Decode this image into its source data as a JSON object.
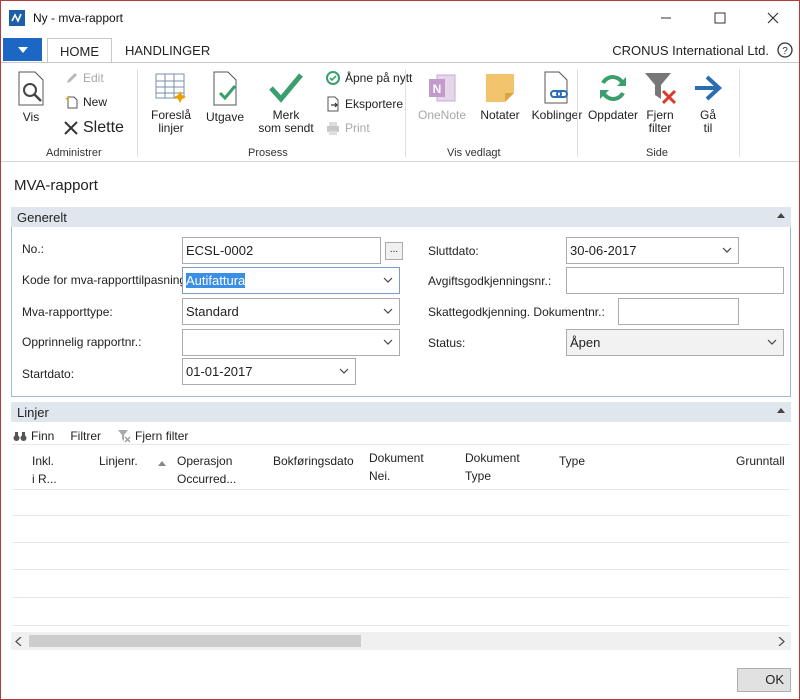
{
  "window": {
    "title": "Ny - mva-rapport"
  },
  "tabs": [
    {
      "label": "HOME"
    },
    {
      "label": "HANDLINGER"
    }
  ],
  "company": "CRONUS International Ltd.",
  "ribbon": {
    "administrer": {
      "label": "Administrer",
      "vis": "Vis",
      "edit": "Edit",
      "new": "New",
      "slette": "Slette"
    },
    "prosess": {
      "label": "Prosess",
      "foresla_line1": "Foreslå",
      "foresla_line2": "linjer",
      "utgave": "Utgave",
      "merk_line1": "Merk",
      "merk_line2": "som sendt",
      "apne": "Åpne på nytt",
      "eksportere": "Eksportere",
      "print": "Print"
    },
    "vedlagt": {
      "label": "Vis vedlagt",
      "onenote": "OneNote",
      "notater": "Notater",
      "koblinger": "Koblinger"
    },
    "side": {
      "label": "Side",
      "oppdater": "Oppdater",
      "fjern_line1": "Fjern",
      "fjern_line2": "filter",
      "ga_line1": "Gå",
      "ga_line2": "til"
    }
  },
  "page_title": "MVA-rapport",
  "general": {
    "header": "Generelt",
    "no_label": "No.:",
    "no_value": "ECSL-0002",
    "kode_label": "Kode for mva-rapporttilpasning:",
    "kode_value": "Autifattura",
    "type_label": "Mva-rapporttype:",
    "type_value": "Standard",
    "opprinnelig_label": "Opprinnelig rapportnr.:",
    "opprinnelig_value": "",
    "startdato_label": "Startdato:",
    "startdato_value": "01-01-2017",
    "sluttdato_label": "Sluttdato:",
    "sluttdato_value": "30-06-2017",
    "avgift_label": "Avgiftsgodkjenningsnr.:",
    "avgift_value": "",
    "skatt_label": "Skattegodkjenning. Dokumentnr.:",
    "skatt_value": "",
    "status_label": "Status:",
    "status_value": "Åpen"
  },
  "lines": {
    "header": "Linjer",
    "finn": "Finn",
    "filtrer": "Filtrer",
    "fjern_filter": "Fjern filter",
    "columns": [
      {
        "l1": "Inkl.",
        "l2": "i R..."
      },
      {
        "l1": "Linjenr.",
        "l2": ""
      },
      {
        "l1": "Operasjon",
        "l2": "Occurred..."
      },
      {
        "l1": "Bokføringsdato",
        "l2": ""
      },
      {
        "l1": "Dokument",
        "l2": "Nei."
      },
      {
        "l1": "Dokument",
        "l2": "Type"
      },
      {
        "l1": "Type",
        "l2": ""
      },
      {
        "l1": "Grunntall",
        "l2": ""
      }
    ]
  },
  "ok_label": "OK"
}
